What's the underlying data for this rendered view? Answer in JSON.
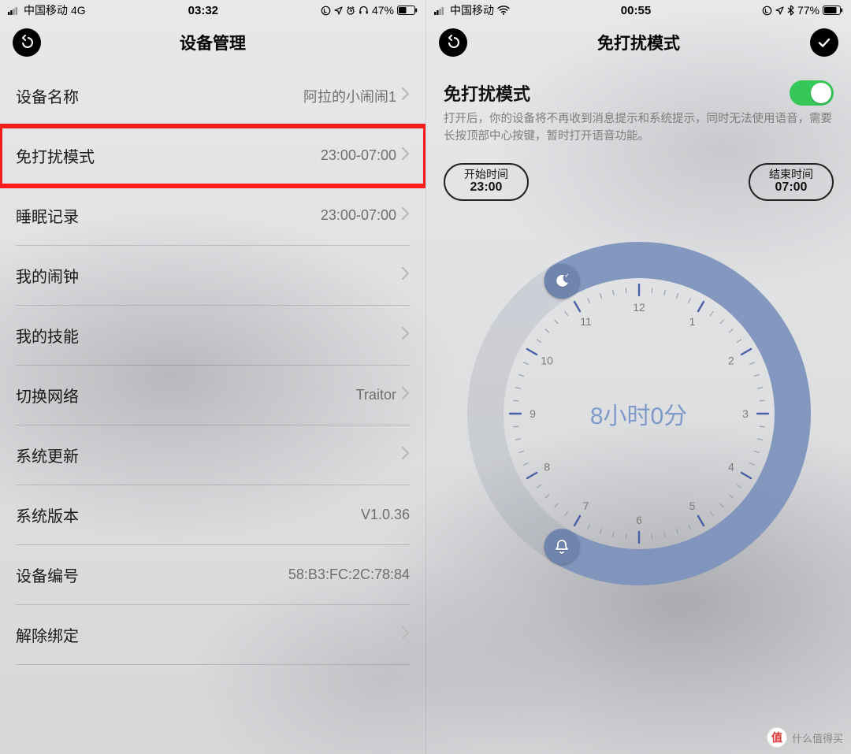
{
  "left": {
    "status": {
      "carrier": "中国移动",
      "net": "4G",
      "time": "03:32",
      "battery": "47%"
    },
    "title": "设备管理",
    "rows": [
      {
        "label": "设备名称",
        "value": "阿拉的小闹闹1",
        "chevron": true,
        "highlight": false
      },
      {
        "label": "免打扰模式",
        "value": "23:00-07:00",
        "chevron": true,
        "highlight": true
      },
      {
        "label": "睡眠记录",
        "value": "23:00-07:00",
        "chevron": true,
        "highlight": false
      },
      {
        "label": "我的闹钟",
        "value": "",
        "chevron": true,
        "highlight": false
      },
      {
        "label": "我的技能",
        "value": "",
        "chevron": true,
        "highlight": false
      },
      {
        "label": "切换网络",
        "value": "Traitor",
        "chevron": true,
        "highlight": false
      },
      {
        "label": "系统更新",
        "value": "",
        "chevron": true,
        "highlight": false
      },
      {
        "label": "系统版本",
        "value": "V1.0.36",
        "chevron": false,
        "highlight": false
      },
      {
        "label": "设备编号",
        "value": "58:B3:FC:2C:78:84",
        "chevron": false,
        "highlight": false
      },
      {
        "label": "解除绑定",
        "value": "",
        "chevron": true,
        "highlight": false
      }
    ]
  },
  "right": {
    "status": {
      "carrier": "中国移动",
      "time": "00:55",
      "battery": "77%"
    },
    "title": "免打扰模式",
    "section_title": "免打扰模式",
    "toggle_on": true,
    "desc": "打开后，你的设备将不再收到消息提示和系统提示，同时无法使用语音，需要长按顶部中心按键，暂时打开语音功能。",
    "start": {
      "label": "开始时间",
      "value": "23:00"
    },
    "end": {
      "label": "结束时间",
      "value": "07:00"
    },
    "duration": "8小时0分",
    "arc": {
      "start_deg": 330,
      "end_deg": 210
    },
    "hours": [
      "12",
      "1",
      "2",
      "3",
      "4",
      "5",
      "6",
      "7",
      "8",
      "9",
      "10",
      "11"
    ]
  },
  "watermark": "什么值得买"
}
